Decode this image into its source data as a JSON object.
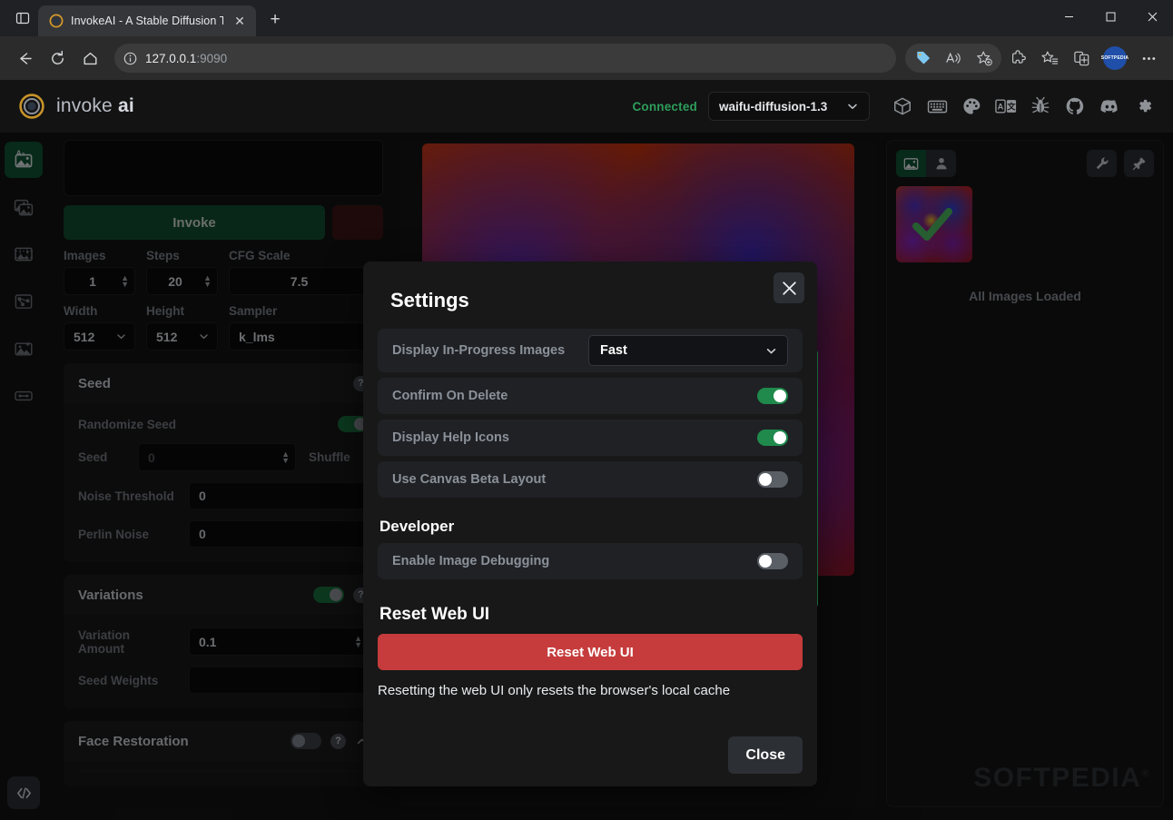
{
  "browser": {
    "tab": {
      "title": "InvokeAI - A Stable Diffusion Too",
      "favicon_icon": "invoke-logo-icon",
      "close_icon": "✕"
    },
    "new_tab_label": "+",
    "sidebar_toggle_icon": "split-pane-icon",
    "window_controls": {
      "minimize": "—",
      "maximize": "▢",
      "close": "✕"
    },
    "nav": {
      "back_icon": "←",
      "reload_icon": "⟳",
      "home_icon": "⌂"
    },
    "omnibox": {
      "info_icon": "ⓘ",
      "url_host": "127.0.0.1",
      "url_port": ":9090"
    },
    "toolbar_right": [
      {
        "name": "shopping-tag-icon"
      },
      {
        "name": "read-aloud-icon"
      },
      {
        "name": "add-favorite-icon"
      },
      {
        "name": "extensions-icon"
      },
      {
        "name": "collections-icon"
      },
      {
        "name": "split-screen-icon"
      },
      {
        "name": "profile-avatar",
        "label": "SOFTPEDIA"
      },
      {
        "name": "more-options-icon"
      }
    ]
  },
  "app": {
    "logo": {
      "mark": "invoke-logo-icon",
      "word": "invoke",
      "bold": "ai"
    },
    "status": "Connected",
    "model": {
      "value": "waifu-diffusion-1.3",
      "chevron": "⌄"
    },
    "header_icons": [
      {
        "name": "models-cube-icon"
      },
      {
        "name": "hotkeys-keyboard-icon"
      },
      {
        "name": "theme-palette-icon"
      },
      {
        "name": "language-icon"
      },
      {
        "name": "bug-report-icon"
      },
      {
        "name": "github-icon"
      },
      {
        "name": "discord-icon"
      },
      {
        "name": "settings-gear-icon"
      }
    ],
    "rail": [
      {
        "name": "text-to-image-tab",
        "active": true
      },
      {
        "name": "image-to-image-tab",
        "active": false
      },
      {
        "name": "unified-canvas-tab",
        "active": false
      },
      {
        "name": "nodes-tab",
        "active": false
      },
      {
        "name": "post-processing-tab",
        "active": false
      },
      {
        "name": "training-tab",
        "active": false
      }
    ],
    "rail_bottom_icon": "code-embed-icon"
  },
  "options": {
    "prompt_placeholder": "",
    "invoke_label": "Invoke",
    "params": [
      {
        "label": "Images",
        "value": "1",
        "type": "number"
      },
      {
        "label": "Steps",
        "value": "20",
        "type": "number"
      },
      {
        "label": "CFG Scale",
        "value": "7.5",
        "type": "number"
      }
    ],
    "params2": [
      {
        "label": "Width",
        "value": "512",
        "type": "select"
      },
      {
        "label": "Height",
        "value": "512",
        "type": "select"
      },
      {
        "label": "Sampler",
        "value": "k_lms",
        "type": "select"
      }
    ],
    "seed": {
      "title": "Seed",
      "randomize_label": "Randomize Seed",
      "randomize_on": true,
      "seed_label": "Seed",
      "seed_value": "0",
      "shuffle_label": "Shuffle",
      "noise_threshold_label": "Noise Threshold",
      "noise_threshold_value": "0",
      "perlin_noise_label": "Perlin Noise",
      "perlin_noise_value": "0"
    },
    "variations": {
      "title": "Variations",
      "enabled": true,
      "amount_label": "Variation Amount",
      "amount_value": "0.1",
      "weights_label": "Seed Weights",
      "weights_value": ""
    },
    "face_restoration": {
      "title": "Face Restoration",
      "enabled": false,
      "collapse_icon": "chevron-up-icon"
    }
  },
  "gallery": {
    "segments": [
      {
        "name": "generations-segment",
        "icon": "image-icon",
        "active": true
      },
      {
        "name": "uploads-segment",
        "icon": "person-icon",
        "active": false
      }
    ],
    "settings_icon": "wrench-icon",
    "pin_icon": "pin-icon",
    "status_text": "All Images Loaded",
    "thumbnail_selected_icon": "green-check-icon",
    "watermark": "SOFTPEDIA",
    "watermark_sup": "®"
  },
  "modal": {
    "title": "Settings",
    "close_icon": "✕",
    "rows": [
      {
        "label": "Display In-Progress Images",
        "control": "select",
        "value": "Fast",
        "chevron": "⌄"
      },
      {
        "label": "Confirm On Delete",
        "control": "toggle",
        "on": true
      },
      {
        "label": "Display Help Icons",
        "control": "toggle",
        "on": true
      },
      {
        "label": "Use Canvas Beta Layout",
        "control": "toggle",
        "on": false
      }
    ],
    "developer_heading": "Developer",
    "developer_row": {
      "label": "Enable Image Debugging",
      "on": false
    },
    "reset_heading": "Reset Web UI",
    "reset_button": "Reset Web UI",
    "reset_note": "Resetting the web UI only resets the browser's local cache",
    "close_button": "Close",
    "accent_red": "#c63c3c",
    "accent_green": "#1f8a4c"
  }
}
